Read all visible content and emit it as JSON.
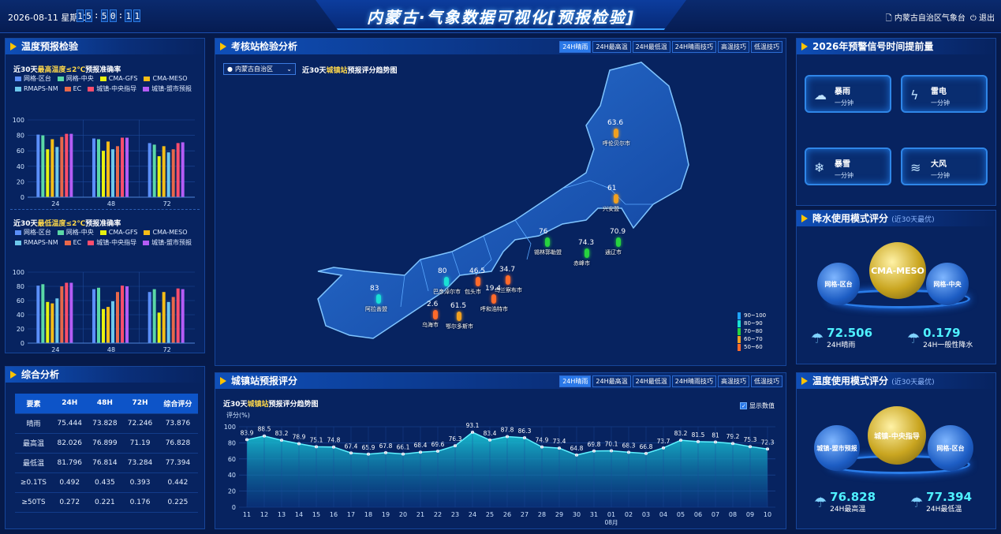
{
  "header": {
    "date": "2026-08-11 星期二",
    "time_digits": [
      "1",
      "5",
      ":",
      "5",
      "0",
      ":",
      "1",
      "1"
    ],
    "title": "内蒙古·气象数据可视化[预报检验]",
    "org": "内蒙古自治区气象台",
    "logout": "退出"
  },
  "temp_panel": {
    "title": "温度预报检验",
    "max_sub_pre": "近30天",
    "max_sub_hl": "最高温度≤2℃",
    "max_sub_post": "预报准确率",
    "min_sub_pre": "近30天",
    "min_sub_hl": "最低温度≤2℃",
    "min_sub_post": "预报准确率",
    "legend": [
      "网格-区台",
      "网格-中央",
      "CMA-GFS",
      "CMA-MESO",
      "RMAPS-NM",
      "EC",
      "城镇-中央指导",
      "城镇-盟市预报"
    ],
    "colors": [
      "#5b8ff9",
      "#5ad8a6",
      "#e8f20f",
      "#f6bd16",
      "#6dc8ec",
      "#e8684a",
      "#ff4d6d",
      "#b45cf5"
    ]
  },
  "chart_data": [
    {
      "type": "bar",
      "title": "近30天最高温度≤2℃预报准确率",
      "categories": [
        "24",
        "48",
        "72"
      ],
      "ylim": [
        0,
        100
      ],
      "yticks": [
        0,
        20,
        40,
        60,
        80,
        100
      ],
      "series": [
        {
          "name": "网格-区台",
          "values": [
            81,
            76,
            70
          ]
        },
        {
          "name": "网格-中央",
          "values": [
            80,
            75,
            68
          ]
        },
        {
          "name": "CMA-GFS",
          "values": [
            62,
            60,
            53
          ]
        },
        {
          "name": "CMA-MESO",
          "values": [
            75,
            72,
            66
          ]
        },
        {
          "name": "RMAPS-NM",
          "values": [
            65,
            62,
            58
          ]
        },
        {
          "name": "EC",
          "values": [
            78,
            66,
            62
          ]
        },
        {
          "name": "城镇-中央指导",
          "values": [
            82,
            77,
            70
          ]
        },
        {
          "name": "城镇-盟市预报",
          "values": [
            82,
            77,
            71
          ]
        }
      ]
    },
    {
      "type": "bar",
      "title": "近30天最低温度≤2℃预报准确率",
      "categories": [
        "24",
        "48",
        "72"
      ],
      "ylim": [
        0,
        100
      ],
      "yticks": [
        0,
        20,
        40,
        60,
        80,
        100
      ],
      "series": [
        {
          "name": "网格-区台",
          "values": [
            81,
            76,
            72
          ]
        },
        {
          "name": "网格-中央",
          "values": [
            83,
            78,
            76
          ]
        },
        {
          "name": "CMA-GFS",
          "values": [
            58,
            48,
            43
          ]
        },
        {
          "name": "CMA-MESO",
          "values": [
            56,
            51,
            72
          ]
        },
        {
          "name": "RMAPS-NM",
          "values": [
            63,
            59,
            58
          ]
        },
        {
          "name": "EC",
          "values": [
            80,
            72,
            65
          ]
        },
        {
          "name": "城镇-中央指导",
          "values": [
            85,
            81,
            77
          ]
        },
        {
          "name": "城镇-盟市预报",
          "values": [
            85,
            80,
            76
          ]
        }
      ]
    },
    {
      "type": "area",
      "title": "近30天城镇站预报评分趋势图",
      "ylabel": "评分(%)",
      "xlabel": "08月",
      "ylim": [
        0,
        100
      ],
      "yticks": [
        0,
        20,
        40,
        60,
        80,
        100
      ],
      "x": [
        "11",
        "12",
        "13",
        "14",
        "15",
        "16",
        "17",
        "18",
        "19",
        "20",
        "21",
        "22",
        "23",
        "24",
        "25",
        "26",
        "27",
        "28",
        "29",
        "30",
        "31",
        "01",
        "02",
        "03",
        "04",
        "05",
        "06",
        "07",
        "08",
        "09",
        "10"
      ],
      "values": [
        83.9,
        88.5,
        83.2,
        78.9,
        75.1,
        74.8,
        67.4,
        65.9,
        67.8,
        66.1,
        68.4,
        69.6,
        76.3,
        93.1,
        83.4,
        87.8,
        86.3,
        74.9,
        73.4,
        64.8,
        69.8,
        70.1,
        68.3,
        66.8,
        73.7,
        83.2,
        81.5,
        81,
        79.2,
        75.3,
        72.3
      ]
    }
  ],
  "overall": {
    "title": "综合分析",
    "headers": [
      "要素",
      "24H",
      "48H",
      "72H",
      "综合评分"
    ],
    "rows": [
      [
        "晴雨",
        "75.444",
        "73.828",
        "72.246",
        "73.876"
      ],
      [
        "最高温",
        "82.026",
        "76.899",
        "71.19",
        "76.828"
      ],
      [
        "最低温",
        "81.796",
        "76.814",
        "73.284",
        "77.394"
      ],
      [
        "≥0.1TS",
        "0.492",
        "0.435",
        "0.393",
        "0.442"
      ],
      [
        "≥50TS",
        "0.272",
        "0.221",
        "0.176",
        "0.225"
      ]
    ]
  },
  "map_panel": {
    "title": "考核站检验分析",
    "tabs": [
      "24H晴雨",
      "24H最高温",
      "24H最低温",
      "24H晴雨技巧",
      "高温技巧",
      "低温技巧"
    ],
    "region": "内蒙古自治区",
    "sub_pre": "近30天",
    "sub_hl": "城镇站",
    "sub_post": "预报评分趋势图",
    "cities": [
      {
        "name": "呼伦贝尔市",
        "value": "63.6"
      },
      {
        "name": "兴安盟",
        "value": "61"
      },
      {
        "name": "通辽市",
        "value": "70.9"
      },
      {
        "name": "锡林郭勒盟",
        "value": "76"
      },
      {
        "name": "赤峰市",
        "value": "74.3"
      },
      {
        "name": "乌兰察布市",
        "value": "34.7"
      },
      {
        "name": "包头市",
        "value": "46.5"
      },
      {
        "name": "呼和浩特市",
        "value": "19.4"
      },
      {
        "name": "巴彦淖尔市",
        "value": "80"
      },
      {
        "name": "鄂尔多斯市",
        "value": "61.5"
      },
      {
        "name": "乌海市",
        "value": "2.6"
      },
      {
        "name": "阿拉善盟",
        "value": "83"
      }
    ],
    "color_legend": [
      {
        "label": "90~100",
        "color": "#1fa3ff"
      },
      {
        "label": "80~90",
        "color": "#19e0d5"
      },
      {
        "label": "70~80",
        "color": "#27d33f"
      },
      {
        "label": "60~70",
        "color": "#f0a020"
      },
      {
        "label": "50~60",
        "color": "#ff6a2a"
      }
    ]
  },
  "town_panel": {
    "title": "城镇站预报评分",
    "tabs": [
      "24H晴雨",
      "24H最高温",
      "24H最低温",
      "24H晴雨技巧",
      "高温技巧",
      "低温技巧"
    ],
    "sub_pre": "近30天",
    "sub_hl": "城镇站",
    "sub_post": "预报评分趋势图",
    "show_values": "显示数值"
  },
  "warn_panel": {
    "title": "2026年预警信号时间提前量",
    "items": [
      {
        "name": "暴雨",
        "value": "一分钟",
        "icon": "rain-cloud-icon"
      },
      {
        "name": "雷电",
        "value": "一分钟",
        "icon": "lightning-icon"
      },
      {
        "name": "暴雪",
        "value": "一分钟",
        "icon": "snow-cloud-icon"
      },
      {
        "name": "大风",
        "value": "一分钟",
        "icon": "wind-icon"
      }
    ]
  },
  "precip_panel": {
    "title": "降水使用模式评分",
    "note": "(近30天最优)",
    "left": "网格-区台",
    "center": "CMA-MESO",
    "right": "网格-中央",
    "stat1_value": "72.506",
    "stat1_label": "24H晴雨",
    "stat2_value": "0.179",
    "stat2_label": "24H一般性降水"
  },
  "tempmodel_panel": {
    "title": "温度使用模式评分",
    "note": "(近30天最优)",
    "left": "城镇-盟市预报",
    "center": "城镇-中央指导",
    "right": "网格-区台",
    "stat1_value": "76.828",
    "stat1_label": "24H最高温",
    "stat2_value": "77.394",
    "stat2_label": "24H最低温"
  }
}
